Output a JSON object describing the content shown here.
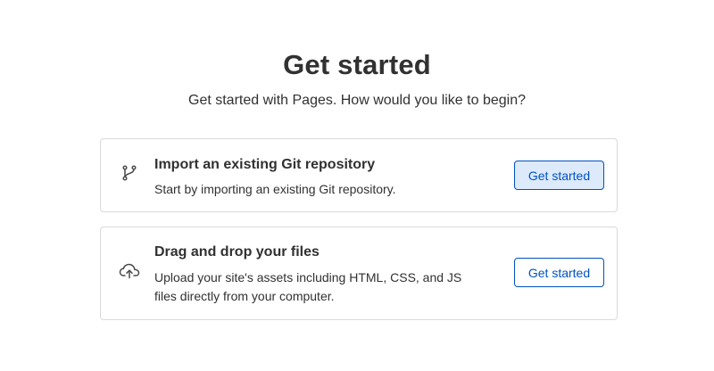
{
  "header": {
    "title": "Get started",
    "subtitle": "Get started with Pages. How would you like to begin?"
  },
  "options": [
    {
      "icon": "git-branch-icon",
      "title": "Import an existing Git repository",
      "description": "Start by importing an existing Git repository.",
      "button_label": "Get started",
      "button_state": "hover"
    },
    {
      "icon": "cloud-upload-icon",
      "title": "Drag and drop your files",
      "description": "Upload your site's assets including HTML, CSS, and JS files directly from your computer.",
      "button_label": "Get started",
      "button_state": "default"
    }
  ],
  "colors": {
    "accent": "#0051c3",
    "button_hover_bg": "#dceafb",
    "text": "#313131",
    "border": "#d9d9d9"
  }
}
